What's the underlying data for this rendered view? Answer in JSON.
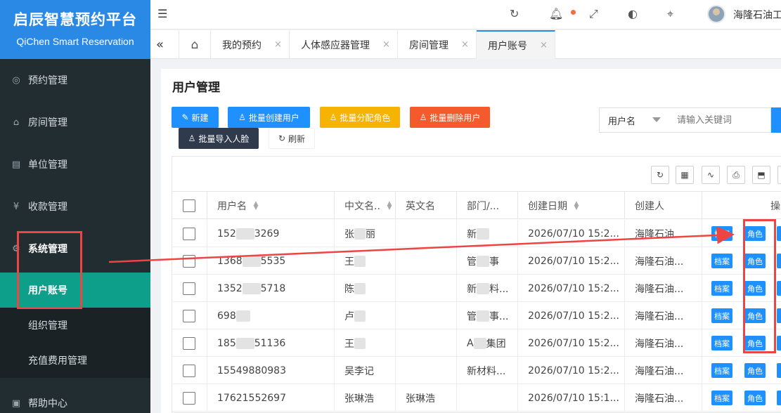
{
  "brand": {
    "title": "启辰智慧预约平台",
    "subtitle": "QiChen Smart Reservation"
  },
  "sidebar": {
    "items": [
      {
        "label": "预约管理",
        "icon": "eye-icon"
      },
      {
        "label": "房间管理",
        "icon": "home-icon"
      },
      {
        "label": "单位管理",
        "icon": "building-icon"
      },
      {
        "label": "收款管理",
        "icon": "yen-icon"
      },
      {
        "label": "系统管理",
        "icon": "gear-icon"
      },
      {
        "label": "帮助中心",
        "icon": "help-icon"
      }
    ],
    "subitems": [
      {
        "label": "用户账号",
        "active": true
      },
      {
        "label": "组织管理"
      },
      {
        "label": "充值费用管理"
      }
    ]
  },
  "header": {
    "username": "海隆石油工",
    "icons": [
      "menu-icon",
      "refresh-icon",
      "bell-icon",
      "fullscreen-icon",
      "palette-icon",
      "tag-icon"
    ]
  },
  "tabs": {
    "items": [
      {
        "label": "我的预约"
      },
      {
        "label": "人体感应器管理"
      },
      {
        "label": "房间管理"
      },
      {
        "label": "用户账号",
        "active": true
      }
    ],
    "close_glyph": "×"
  },
  "page": {
    "title": "用户管理"
  },
  "toolbar": {
    "new_label": "新建",
    "batch_create_label": "批量创建用户",
    "batch_assign_label": "批量分配角色",
    "batch_delete_label": "批量删除用户",
    "batch_import_label": "批量导入人脸",
    "refresh_label": "刷新"
  },
  "search": {
    "field": "用户名",
    "placeholder": "请输入关键词"
  },
  "table": {
    "columns": [
      "用户名",
      "中文名..",
      "英文名",
      "部门/...",
      "创建日期",
      "创建人",
      "操作"
    ],
    "rows": [
      {
        "username": "152",
        "username_tail": "3269",
        "cn": "张",
        "cn_tail": "丽",
        "en": "",
        "dept": "新",
        "dept_tail": "",
        "date": "2026/07/10 15:2...",
        "creator": "海隆石油..."
      },
      {
        "username": "1368",
        "username_tail": "5535",
        "cn": "王",
        "cn_tail": "",
        "en": "",
        "dept": "管",
        "dept_tail": "事",
        "date": "2026/07/10 15:2...",
        "creator": "海隆石油..."
      },
      {
        "username": "1352",
        "username_tail": "5718",
        "cn": "陈",
        "cn_tail": "",
        "en": "",
        "dept": "新",
        "dept_tail": "料...",
        "date": "2026/07/10 15:2...",
        "creator": "海隆石油..."
      },
      {
        "username": "698",
        "username_tail": "",
        "cn": "卢",
        "cn_tail": "",
        "en": "",
        "dept": "管",
        "dept_tail": "事...",
        "date": "2026/07/10 15:2...",
        "creator": "海隆石油..."
      },
      {
        "username": "185",
        "username_tail": "51136",
        "cn": "王",
        "cn_tail": "",
        "en": "",
        "dept": "A",
        "dept_tail": "集团",
        "date": "2026/07/10 15:2...",
        "creator": "海隆石油..."
      },
      {
        "username": "15549880983",
        "username_tail": "",
        "cn": "吴李记",
        "cn_tail": "",
        "en": "",
        "dept": "新材料...",
        "dept_tail": "",
        "date": "2026/07/10 15:2...",
        "creator": "海隆石油..."
      },
      {
        "username": "17621552697",
        "username_tail": "",
        "cn": "张琳浩",
        "cn_tail": "",
        "en": "张琳浩",
        "dept": "",
        "dept_tail": "",
        "date": "2026/07/10 15:1...",
        "creator": "海隆石油..."
      }
    ],
    "op_labels": {
      "profile": "档案",
      "role": "角色"
    }
  },
  "colors": {
    "sidebar_bg": "#222d32",
    "brand_bg": "#2b89e6",
    "active_menu": "#0e9f8b",
    "primary": "#1e90ff",
    "annotation": "#ef4444"
  }
}
